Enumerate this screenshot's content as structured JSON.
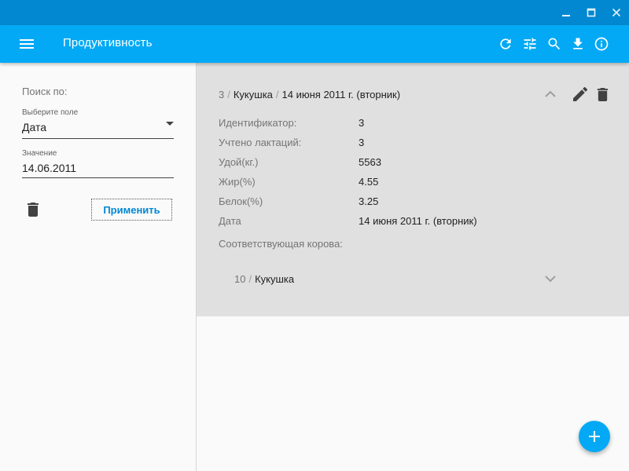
{
  "window": {
    "buttons": [
      "minimize-icon",
      "maximize-icon",
      "close-icon"
    ]
  },
  "appbar": {
    "title": "Продуктивность",
    "actions": [
      "refresh-icon",
      "tune-icon",
      "search-icon",
      "download-icon",
      "info-icon"
    ]
  },
  "sidebar": {
    "search_by": "Поиск по:",
    "field_select": {
      "label": "Выберите поле",
      "value": "Дата"
    },
    "value_field": {
      "label": "Значение",
      "value": "14.06.2011"
    },
    "apply_label": "Применить"
  },
  "record": {
    "breadcrumb": {
      "id": "3",
      "sep": "/",
      "name": "Кукушка",
      "date": "14 июня 2011 г. (вторник)"
    },
    "fields": [
      {
        "label": "Идентификатор:",
        "value": "3"
      },
      {
        "label": "Учтено лактаций:",
        "value": "3"
      },
      {
        "label": "Удой(кг.)",
        "value": "5563"
      },
      {
        "label": "Жир(%)",
        "value": "4.55"
      },
      {
        "label": "Белок(%)",
        "value": "3.25"
      },
      {
        "label": "Дата",
        "value": "14 июня 2011 г. (вторник)"
      }
    ],
    "cow_label": "Соответствующая корова:",
    "cow": {
      "id": "10",
      "sep": "/",
      "name": "Кукушка"
    }
  },
  "colors": {
    "primary": "#03a9f4",
    "primary_dark": "#0288d1",
    "panel_bg": "#e0e0e0"
  }
}
